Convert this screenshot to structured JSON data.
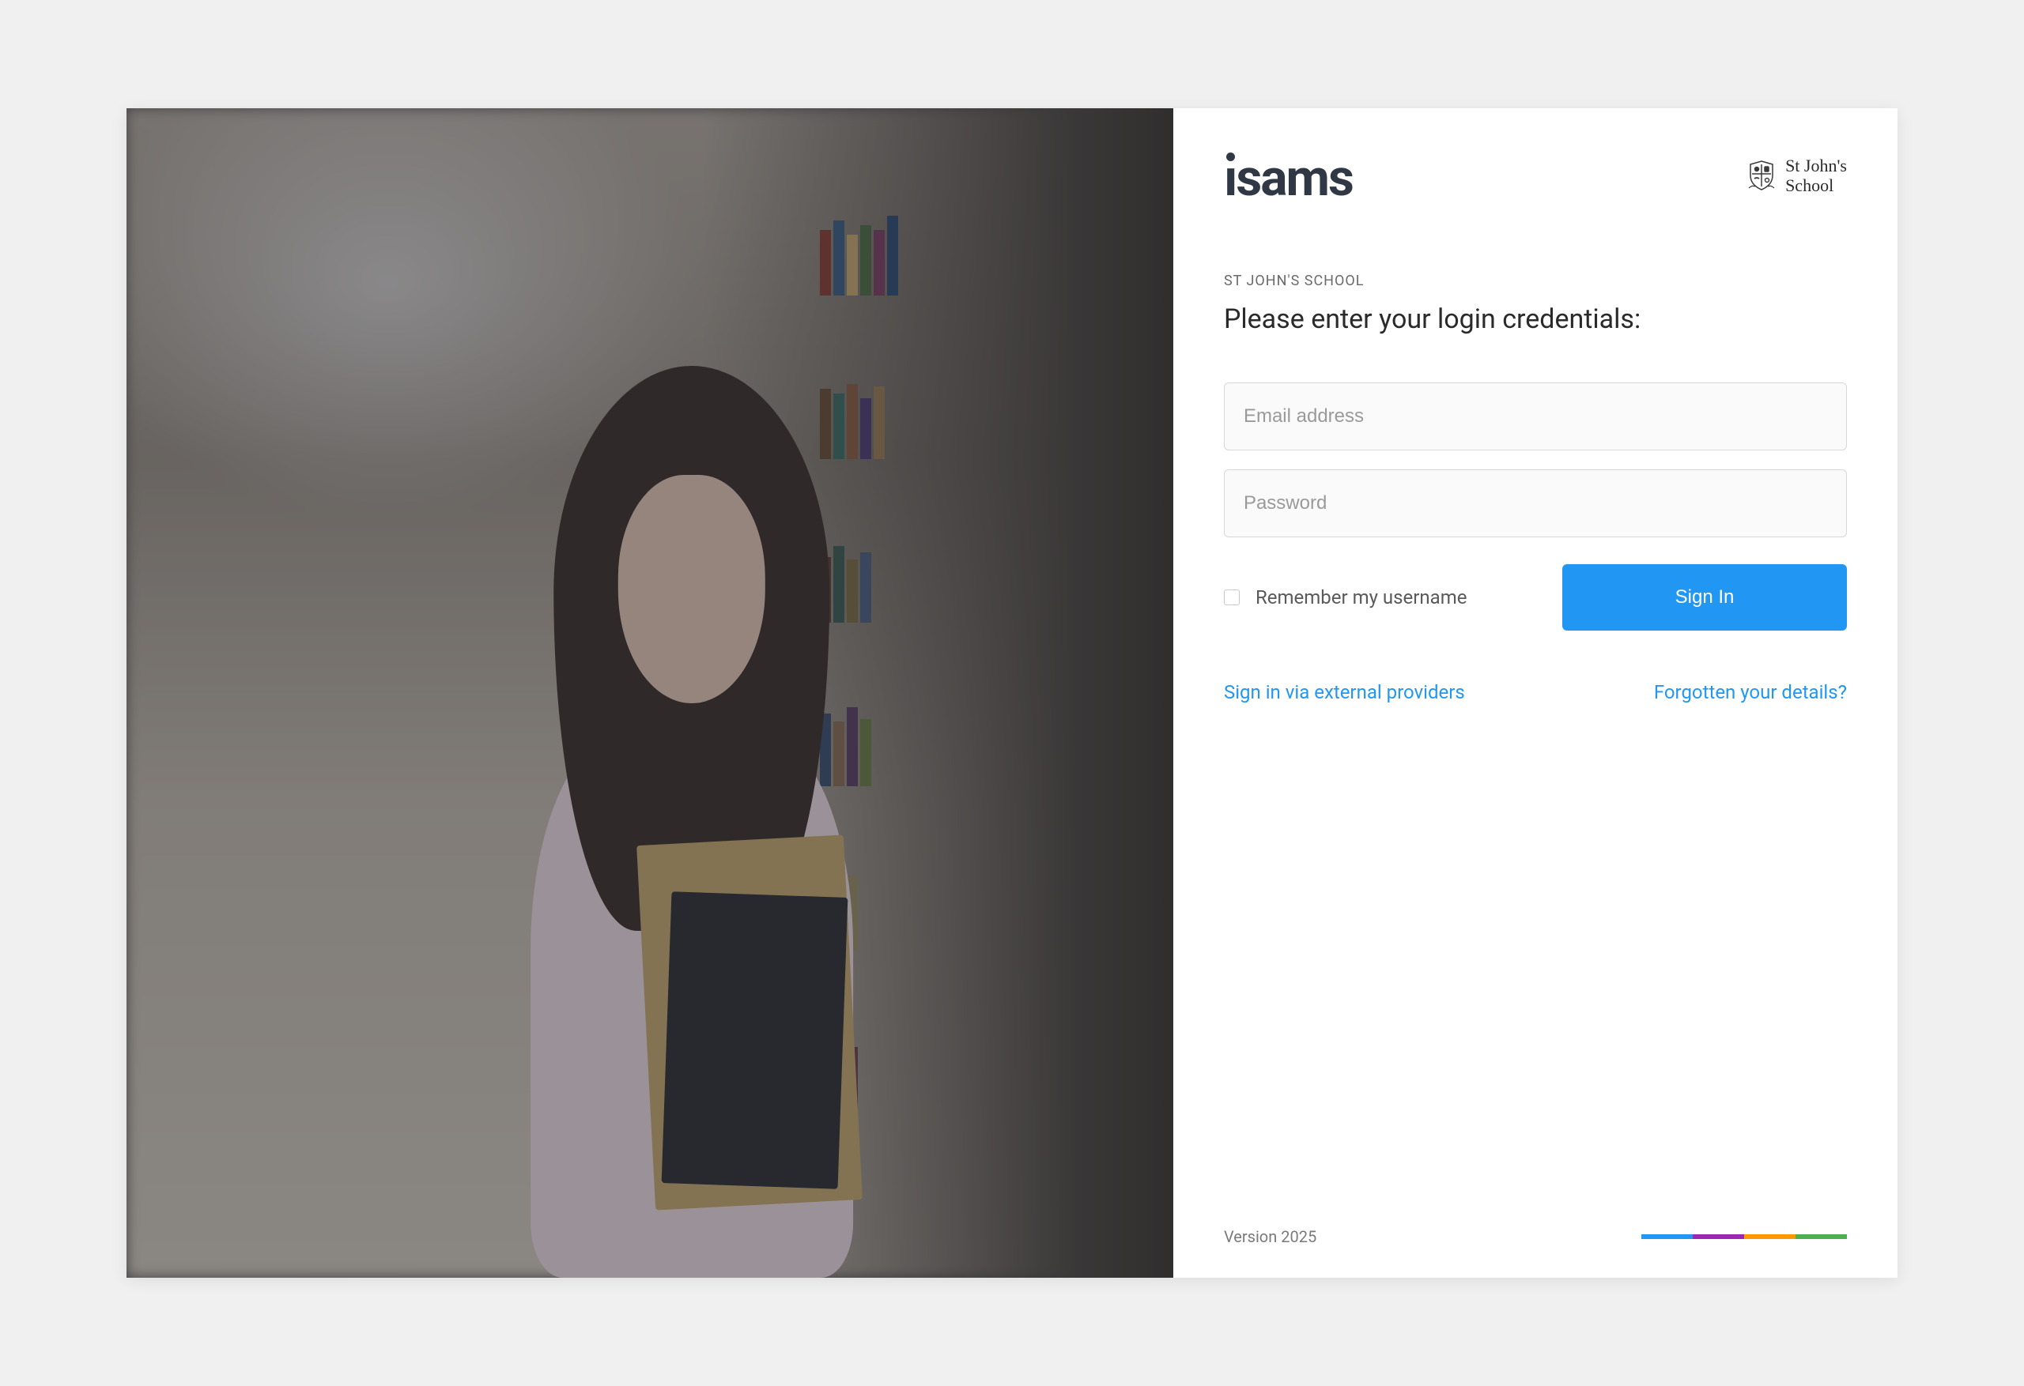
{
  "brand": {
    "logo_text": "ısams"
  },
  "school": {
    "name_line1": "St John's",
    "name_line2": "School",
    "label": "ST JOHN'S SCHOOL"
  },
  "heading": "Please enter your login credentials:",
  "form": {
    "email_placeholder": "Email address",
    "password_placeholder": "Password",
    "remember_label": "Remember my username",
    "signin_label": "Sign In"
  },
  "links": {
    "external_providers": "Sign in via external providers",
    "forgotten": "Forgotten your details?"
  },
  "footer": {
    "version": "Version 2025"
  },
  "colors": {
    "bar": [
      "#2196f3",
      "#9c27b0",
      "#ff9800",
      "#4caf50"
    ]
  }
}
